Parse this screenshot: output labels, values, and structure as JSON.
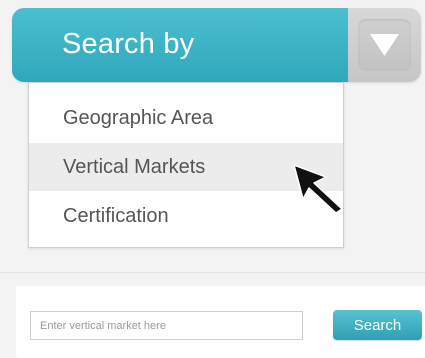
{
  "search_by": {
    "label": "Search by",
    "toggle_icon": "chevron-down-icon",
    "accent_color": "#3ab3c6"
  },
  "dropdown": {
    "items": [
      {
        "label": "Geographic Area",
        "highlighted": false
      },
      {
        "label": "Vertical Markets",
        "highlighted": true
      },
      {
        "label": "Certification",
        "highlighted": false
      }
    ]
  },
  "cursor": {
    "icon": "mouse-pointer-icon"
  },
  "search_form": {
    "input_placeholder": "Enter vertical market here",
    "input_value": "",
    "button_label": "Search"
  }
}
